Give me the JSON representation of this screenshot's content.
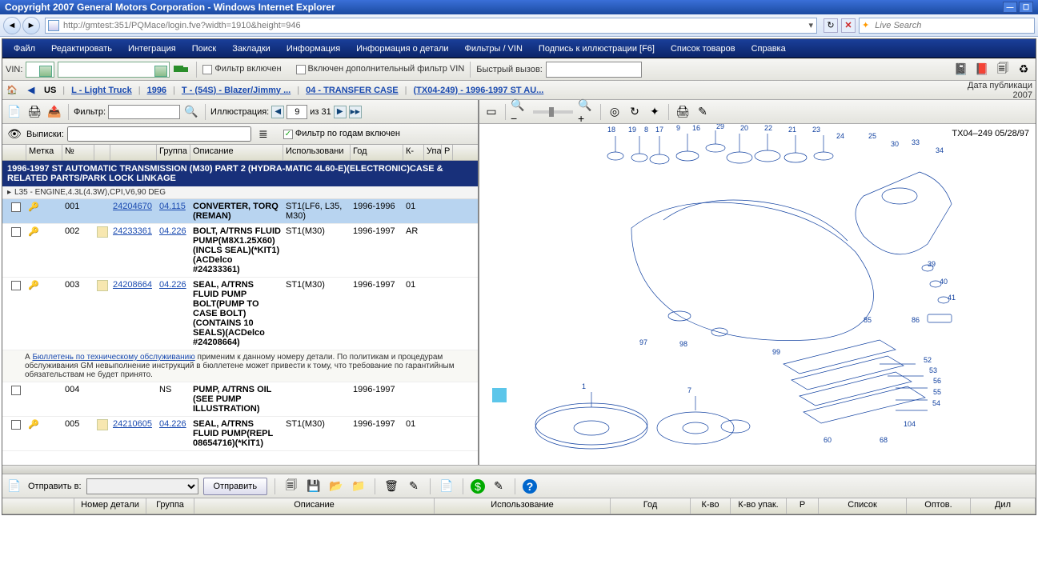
{
  "ie": {
    "title": "Copyright 2007 General Motors Corporation - Windows Internet Explorer",
    "url": "http://gmtest:351/PQMace/login.fve?width=1910&height=946",
    "search_placeholder": "Live Search"
  },
  "menu": {
    "items": [
      "Файл",
      "Редактировать",
      "Интеграция",
      "Поиск",
      "Закладки",
      "Информация",
      "Информация о детали",
      "Фильтры / VIN",
      "Подпись к иллюстрации [F6]",
      "Список товаров",
      "Справка"
    ]
  },
  "vinrow": {
    "vin_label": "VIN:",
    "filter_on": "Фильтр включен",
    "vin_filter_extra": "Включен дополнительный фильтр VIN",
    "quick_call": "Быстрый вызов:"
  },
  "breadcrumb": {
    "country": "US",
    "parts": [
      "L - Light Truck",
      "1996",
      "T - (54S) - Blazer/Jimmy ...",
      "04 - TRANSFER CASE",
      "(TX04-249) - 1996-1997 ST AU..."
    ],
    "pubdate_label": "Дата публикаци",
    "pubdate_year": "2007"
  },
  "leftbar": {
    "filter_label": "Фильтр:",
    "illus_label": "Иллюстрация:",
    "illus_current": "9",
    "illus_total": "из 31",
    "extracts": "Выписки:",
    "year_filter": "Фильтр по годам включен"
  },
  "columns": {
    "mark": "Метка",
    "no": "№",
    "group": "Группа",
    "desc": "Описание",
    "use": "Использовани",
    "year": "Год",
    "q": "К-",
    "pack": "Упа",
    "r": "Р"
  },
  "section_title": "1996-1997 ST AUTOMATIC TRANSMISSION (M30) PART 2 (HYDRA-MATIC 4L60-E)(ELECTRONIC)CASE & RELATED PARTS/PARK LOCK LINKAGE",
  "engine_line": "L35 - ENGINE,4.3L(4.3W),CPI,V6,90 DEG",
  "bulletin": {
    "prefix": "А ",
    "link": "Бюллетень по техническому обслуживанию",
    "rest": " применим к данному номеру детали. По политикам и процедурам обслуживания GM невыполнение инструкций в бюллетене может привести к тому, что требование по гарантийным обязательствам не будет принято."
  },
  "rows": [
    {
      "no": "001",
      "pn": "24204670",
      "group": "04.115",
      "desc": "CONVERTER, TORQ (REMAN)",
      "use": "ST1(LF6, L35, M30)",
      "year": "1996-1996",
      "q": "01",
      "selected": true,
      "note": false,
      "ns": false,
      "key": true
    },
    {
      "no": "002",
      "pn": "24233361",
      "group": "04.226",
      "desc": "BOLT, A/TRNS FLUID PUMP(M8X1.25X60)(INCLS SEAL)(*KIT1)(ACDelco #24233361)",
      "use": "ST1(M30)",
      "year": "1996-1997",
      "q": "AR",
      "selected": false,
      "note": true,
      "ns": false,
      "key": true
    },
    {
      "no": "003",
      "pn": "24208664",
      "group": "04.226",
      "desc": "SEAL, A/TRNS FLUID PUMP BOLT(PUMP TO CASE BOLT)(CONTAINS 10 SEALS)(ACDelco #24208664)",
      "use": "ST1(M30)",
      "year": "1996-1997",
      "q": "01",
      "selected": false,
      "note": true,
      "ns": false,
      "key": true
    },
    {
      "no": "004",
      "pn": "",
      "group": "NS",
      "desc": "PUMP, A/TRNS OIL (SEE PUMP ILLUSTRATION)",
      "use": "",
      "year": "1996-1997",
      "q": "",
      "selected": false,
      "note": false,
      "ns": true,
      "key": false
    },
    {
      "no": "005",
      "pn": "24210605",
      "group": "04.226",
      "desc": "SEAL, A/TRNS FLUID PUMP(REPL 08654716)(*KIT1)",
      "use": "ST1(M30)",
      "year": "1996-1997",
      "q": "01",
      "selected": false,
      "note": true,
      "ns": false,
      "key": true
    }
  ],
  "diagram": {
    "label": "TX04–249  05/28/97"
  },
  "sendbar": {
    "label": "Отправить в:",
    "btn": "Отправить"
  },
  "botcols": {
    "part": "Номер детали",
    "group": "Группа",
    "desc": "Описание",
    "use": "Использование",
    "year": "Год",
    "q": "К-во",
    "pack": "К-во упак.",
    "r": "Р",
    "list": "Список",
    "whole": "Оптов.",
    "dealer": "Дил"
  },
  "icon_glyphs": {
    "home": "🏠",
    "back": "◀",
    "fwd": "▶",
    "print": "🖨",
    "excel": "📊",
    "magnify": "🔍",
    "arrow_l": "◀",
    "arrow_r": "▶",
    "arrow_rr": "▶▶",
    "book": "📘",
    "redbook": "📕",
    "help": "?",
    "copy": "📄",
    "save": "💾",
    "folder": "📂",
    "folder_x": "📁",
    "trash": "🗑",
    "edit": "✎",
    "money": "$",
    "info": "ℹ",
    "page": "📄",
    "zoomin": "🔍+",
    "zoomout": "🔍−",
    "rotate": "↻",
    "target": "◎",
    "fit": "▭",
    "list": "≣",
    "eye": "👁",
    "refresh": "⟳",
    "drop": "▾"
  }
}
